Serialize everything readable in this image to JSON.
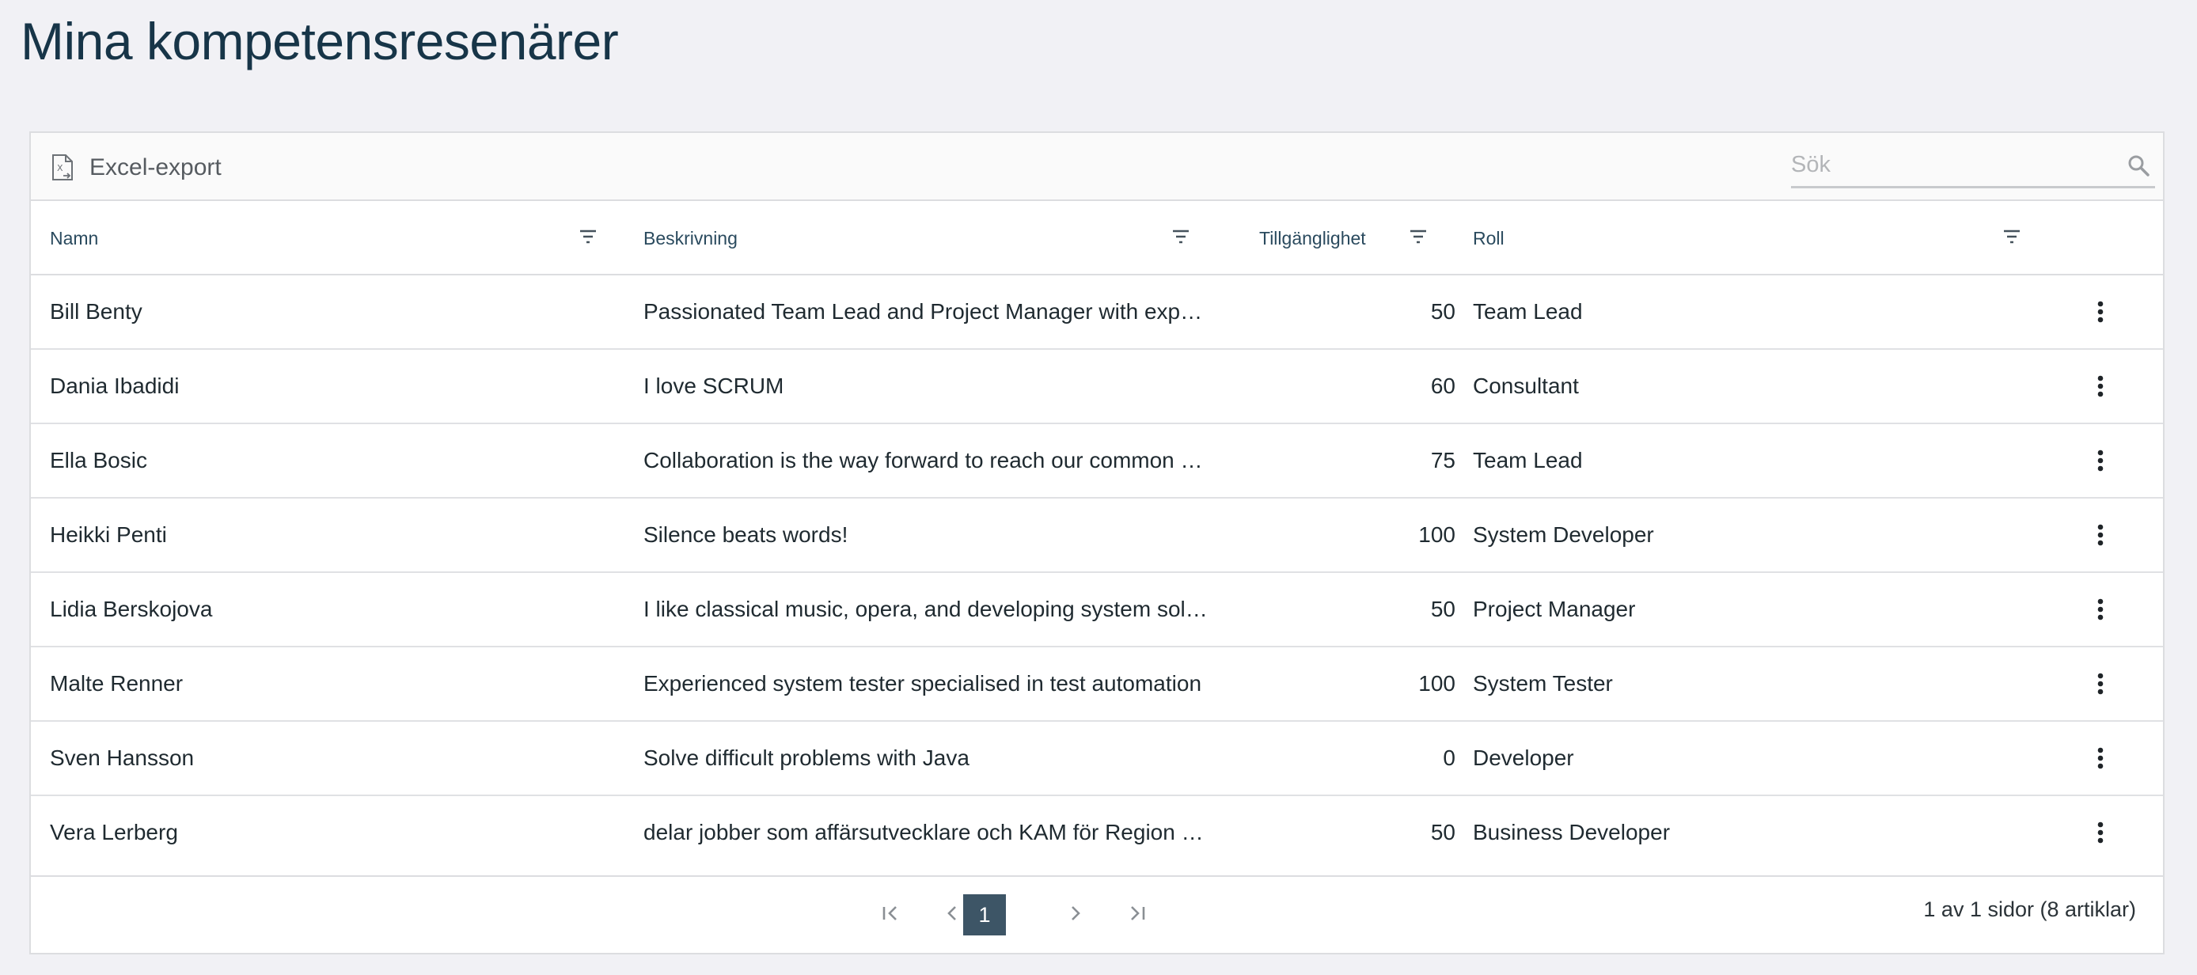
{
  "page": {
    "title": "Mina kompetensresenärer"
  },
  "toolbar": {
    "export_label": "Excel-export",
    "export_icon": "excel-export-icon",
    "search_placeholder": "Sök",
    "search_value": "",
    "search_icon": "search-icon"
  },
  "columns": {
    "name": "Namn",
    "description": "Beskrivning",
    "availability": "Tillgänglighet",
    "role": "Roll"
  },
  "rows": [
    {
      "name": "Bill Benty",
      "description": "Passionated Team Lead and Project Manager with exp…",
      "availability": "50",
      "role": "Team Lead"
    },
    {
      "name": "Dania Ibadidi",
      "description": "I love SCRUM",
      "availability": "60",
      "role": "Consultant"
    },
    {
      "name": "Ella Bosic",
      "description": "Collaboration is the way forward to reach our common …",
      "availability": "75",
      "role": "Team Lead"
    },
    {
      "name": "Heikki Penti",
      "description": "Silence beats words!",
      "availability": "100",
      "role": "System Developer"
    },
    {
      "name": "Lidia Berskojova",
      "description": "I like classical music, opera, and developing system solu…",
      "availability": "50",
      "role": "Project Manager"
    },
    {
      "name": "Malte Renner",
      "description": "Experienced system tester specialised in test automation",
      "availability": "100",
      "role": "System Tester"
    },
    {
      "name": "Sven Hansson",
      "description": "Solve difficult problems with Java",
      "availability": "0",
      "role": "Developer"
    },
    {
      "name": "Vera Lerberg",
      "description": "delar jobber som affärsutvecklare och KAM för Region S…",
      "availability": "50",
      "role": "Business Developer"
    }
  ],
  "pager": {
    "current_page": "1",
    "info": "1 av 1 sidor (8 artiklar)"
  },
  "colors": {
    "accent": "#3d5566",
    "title": "#173548",
    "header_text": "#2a4a5e",
    "background": "#f1f1f5"
  }
}
